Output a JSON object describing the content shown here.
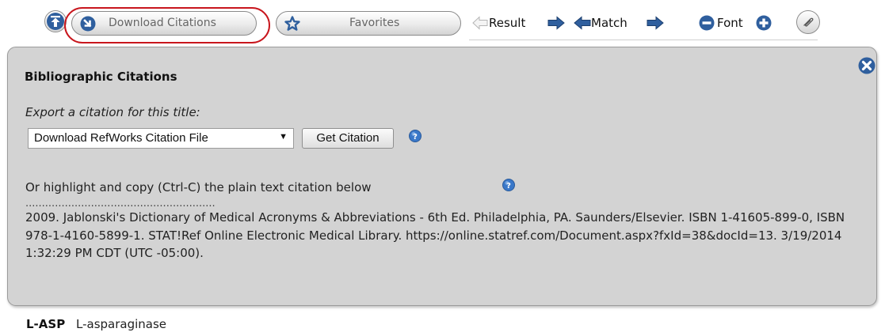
{
  "toolbar": {
    "top_icon": "scroll-to-top-icon",
    "download_label": "Download Citations",
    "download_icon": "download-arrow-icon",
    "favorites_label": "Favorites",
    "favorites_icon": "star-icon",
    "result_label": "Result",
    "match_label": "Match",
    "font_label": "Font",
    "clip_icon": "paperclip-icon"
  },
  "panel": {
    "title": "Bibliographic Citations",
    "export_label": "Export a citation for this title:",
    "format_selected": "Download RefWorks Citation File",
    "get_citation_label": "Get Citation",
    "plain_text_label": "Or highlight and copy (Ctrl-C) the plain text citation below",
    "dots": "..........................................................",
    "citation_text": "2009. Jablonski's Dictionary of Medical Acronyms & Abbreviations - 6th Ed. Philadelphia, PA. Saunders/Elsevier. ISBN 1-41605-899-0, ISBN 978-1-4160-5899-1. STAT!Ref Online Electronic Medical Library. https://online.statref.com/Document.aspx?fxId=38&docId=13. 3/19/2014 1:32:29 PM CDT (UTC -05:00)."
  },
  "entry": {
    "term": "L-ASP",
    "definition": "L-asparaginase"
  },
  "colors": {
    "accent_blue": "#2f5f9e",
    "highlight_red": "#c8161d",
    "panel_bg": "#d3d3d3"
  }
}
